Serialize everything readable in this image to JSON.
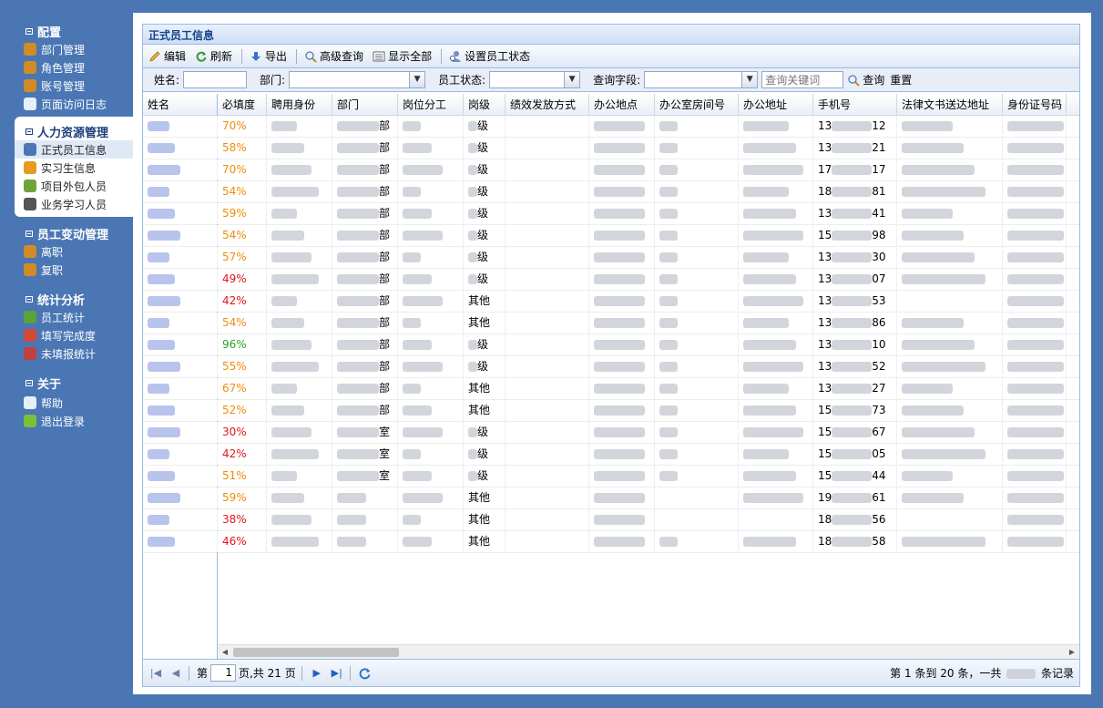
{
  "sidebar": {
    "config": {
      "title": "配置",
      "items": [
        {
          "label": "部门管理",
          "icon": "users-icon",
          "color": "#d18b27"
        },
        {
          "label": "角色管理",
          "icon": "role-icon",
          "color": "#d18b27"
        },
        {
          "label": "账号管理",
          "icon": "account-icon",
          "color": "#d18b27"
        },
        {
          "label": "页面访问日志",
          "icon": "log-icon",
          "color": "#e6eef8"
        }
      ]
    },
    "hr": {
      "title": "人力资源管理",
      "items": [
        {
          "label": "正式员工信息",
          "icon": "employee-icon",
          "color": "#4a76b4"
        },
        {
          "label": "实习生信息",
          "icon": "intern-icon",
          "color": "#e69a22"
        },
        {
          "label": "项目外包人员",
          "icon": "outsource-icon",
          "color": "#6fa33c"
        },
        {
          "label": "业务学习人员",
          "icon": "learner-icon",
          "color": "#555555"
        }
      ]
    },
    "change": {
      "title": "员工变动管理",
      "items": [
        {
          "label": "离职",
          "icon": "leave-icon",
          "color": "#d18b27"
        },
        {
          "label": "复职",
          "icon": "rejoin-icon",
          "color": "#d18b27"
        }
      ]
    },
    "stats": {
      "title": "统计分析",
      "items": [
        {
          "label": "员工统计",
          "icon": "pie-chart-icon",
          "color": "#5aa33a"
        },
        {
          "label": "填写完成度",
          "icon": "bar-chart-icon",
          "color": "#d04a3a"
        },
        {
          "label": "未填报统计",
          "icon": "line-chart-icon",
          "color": "#c04040"
        }
      ]
    },
    "about": {
      "title": "关于",
      "items": [
        {
          "label": "帮助",
          "icon": "help-icon",
          "color": "#e6eef8"
        },
        {
          "label": "退出登录",
          "icon": "logout-icon",
          "color": "#7bbf3a"
        }
      ]
    }
  },
  "panel": {
    "title": "正式员工信息"
  },
  "toolbar": {
    "edit": "编辑",
    "refresh": "刷新",
    "export": "导出",
    "advanced_search": "高级查询",
    "show_all": "显示全部",
    "set_status": "设置员工状态"
  },
  "filter": {
    "name_label": "姓名:",
    "dept_label": "部门:",
    "status_label": "员工状态:",
    "field_label": "查询字段:",
    "keyword_placeholder": "查询关键词",
    "search": "查询",
    "reset": "重置"
  },
  "grid": {
    "columns": [
      "姓名",
      "必填度",
      "聘用身份",
      "部门",
      "岗位分工",
      "岗级",
      "绩效发放方式",
      "办公地点",
      "办公室房间号",
      "办公地址",
      "手机号",
      "法律文书送达地址",
      "身份证号码"
    ],
    "rows": [
      {
        "pct": "70%",
        "c": "o",
        "dept": "部",
        "grade": "级",
        "phone_a": "13",
        "phone_b": "12"
      },
      {
        "pct": "58%",
        "c": "o",
        "dept": "部",
        "grade": "级",
        "phone_a": "13",
        "phone_b": "21"
      },
      {
        "pct": "70%",
        "c": "o",
        "dept": "部",
        "grade": "级",
        "phone_a": "17",
        "phone_b": "17"
      },
      {
        "pct": "54%",
        "c": "o",
        "dept": "部",
        "grade": "级",
        "phone_a": "18",
        "phone_b": "81"
      },
      {
        "pct": "59%",
        "c": "o",
        "dept": "部",
        "grade": "级",
        "phone_a": "13",
        "phone_b": "41"
      },
      {
        "pct": "54%",
        "c": "o",
        "dept": "部",
        "grade": "级",
        "phone_a": "15",
        "phone_b": "98"
      },
      {
        "pct": "57%",
        "c": "o",
        "dept": "部",
        "grade": "级",
        "phone_a": "13",
        "phone_b": "30"
      },
      {
        "pct": "49%",
        "c": "r",
        "dept": "部",
        "grade": "级",
        "phone_a": "13",
        "phone_b": "07"
      },
      {
        "pct": "42%",
        "c": "r",
        "dept": "部",
        "grade": "其他",
        "phone_a": "13",
        "phone_b": "53"
      },
      {
        "pct": "54%",
        "c": "o",
        "dept": "部",
        "grade": "其他",
        "phone_a": "13",
        "phone_b": "86"
      },
      {
        "pct": "96%",
        "c": "g",
        "dept": "部",
        "grade": "级",
        "phone_a": "13",
        "phone_b": "10"
      },
      {
        "pct": "55%",
        "c": "o",
        "dept": "部",
        "grade": "级",
        "phone_a": "13",
        "phone_b": "52"
      },
      {
        "pct": "67%",
        "c": "o",
        "dept": "部",
        "grade": "其他",
        "phone_a": "13",
        "phone_b": "27"
      },
      {
        "pct": "52%",
        "c": "o",
        "dept": "部",
        "grade": "其他",
        "phone_a": "15",
        "phone_b": "73"
      },
      {
        "pct": "30%",
        "c": "r",
        "dept": "室",
        "grade": "级",
        "phone_a": "15",
        "phone_b": "67"
      },
      {
        "pct": "42%",
        "c": "r",
        "dept": "室",
        "grade": "级",
        "phone_a": "15",
        "phone_b": "05"
      },
      {
        "pct": "51%",
        "c": "o",
        "dept": "室",
        "grade": "级",
        "phone_a": "15",
        "phone_b": "44"
      },
      {
        "pct": "59%",
        "c": "o",
        "dept": "",
        "grade": "其他",
        "phone_a": "19",
        "phone_b": "61"
      },
      {
        "pct": "38%",
        "c": "r",
        "dept": "",
        "grade": "其他",
        "phone_a": "18",
        "phone_b": "56"
      },
      {
        "pct": "46%",
        "c": "r",
        "dept": "",
        "grade": "其他",
        "phone_a": "18",
        "phone_b": "58"
      }
    ]
  },
  "pager": {
    "page_prefix": "第",
    "page_value": "1",
    "page_suffix": "页,共 21 页",
    "info_prefix": "第 1 条到 20 条，一共",
    "info_suffix": "条记录"
  }
}
